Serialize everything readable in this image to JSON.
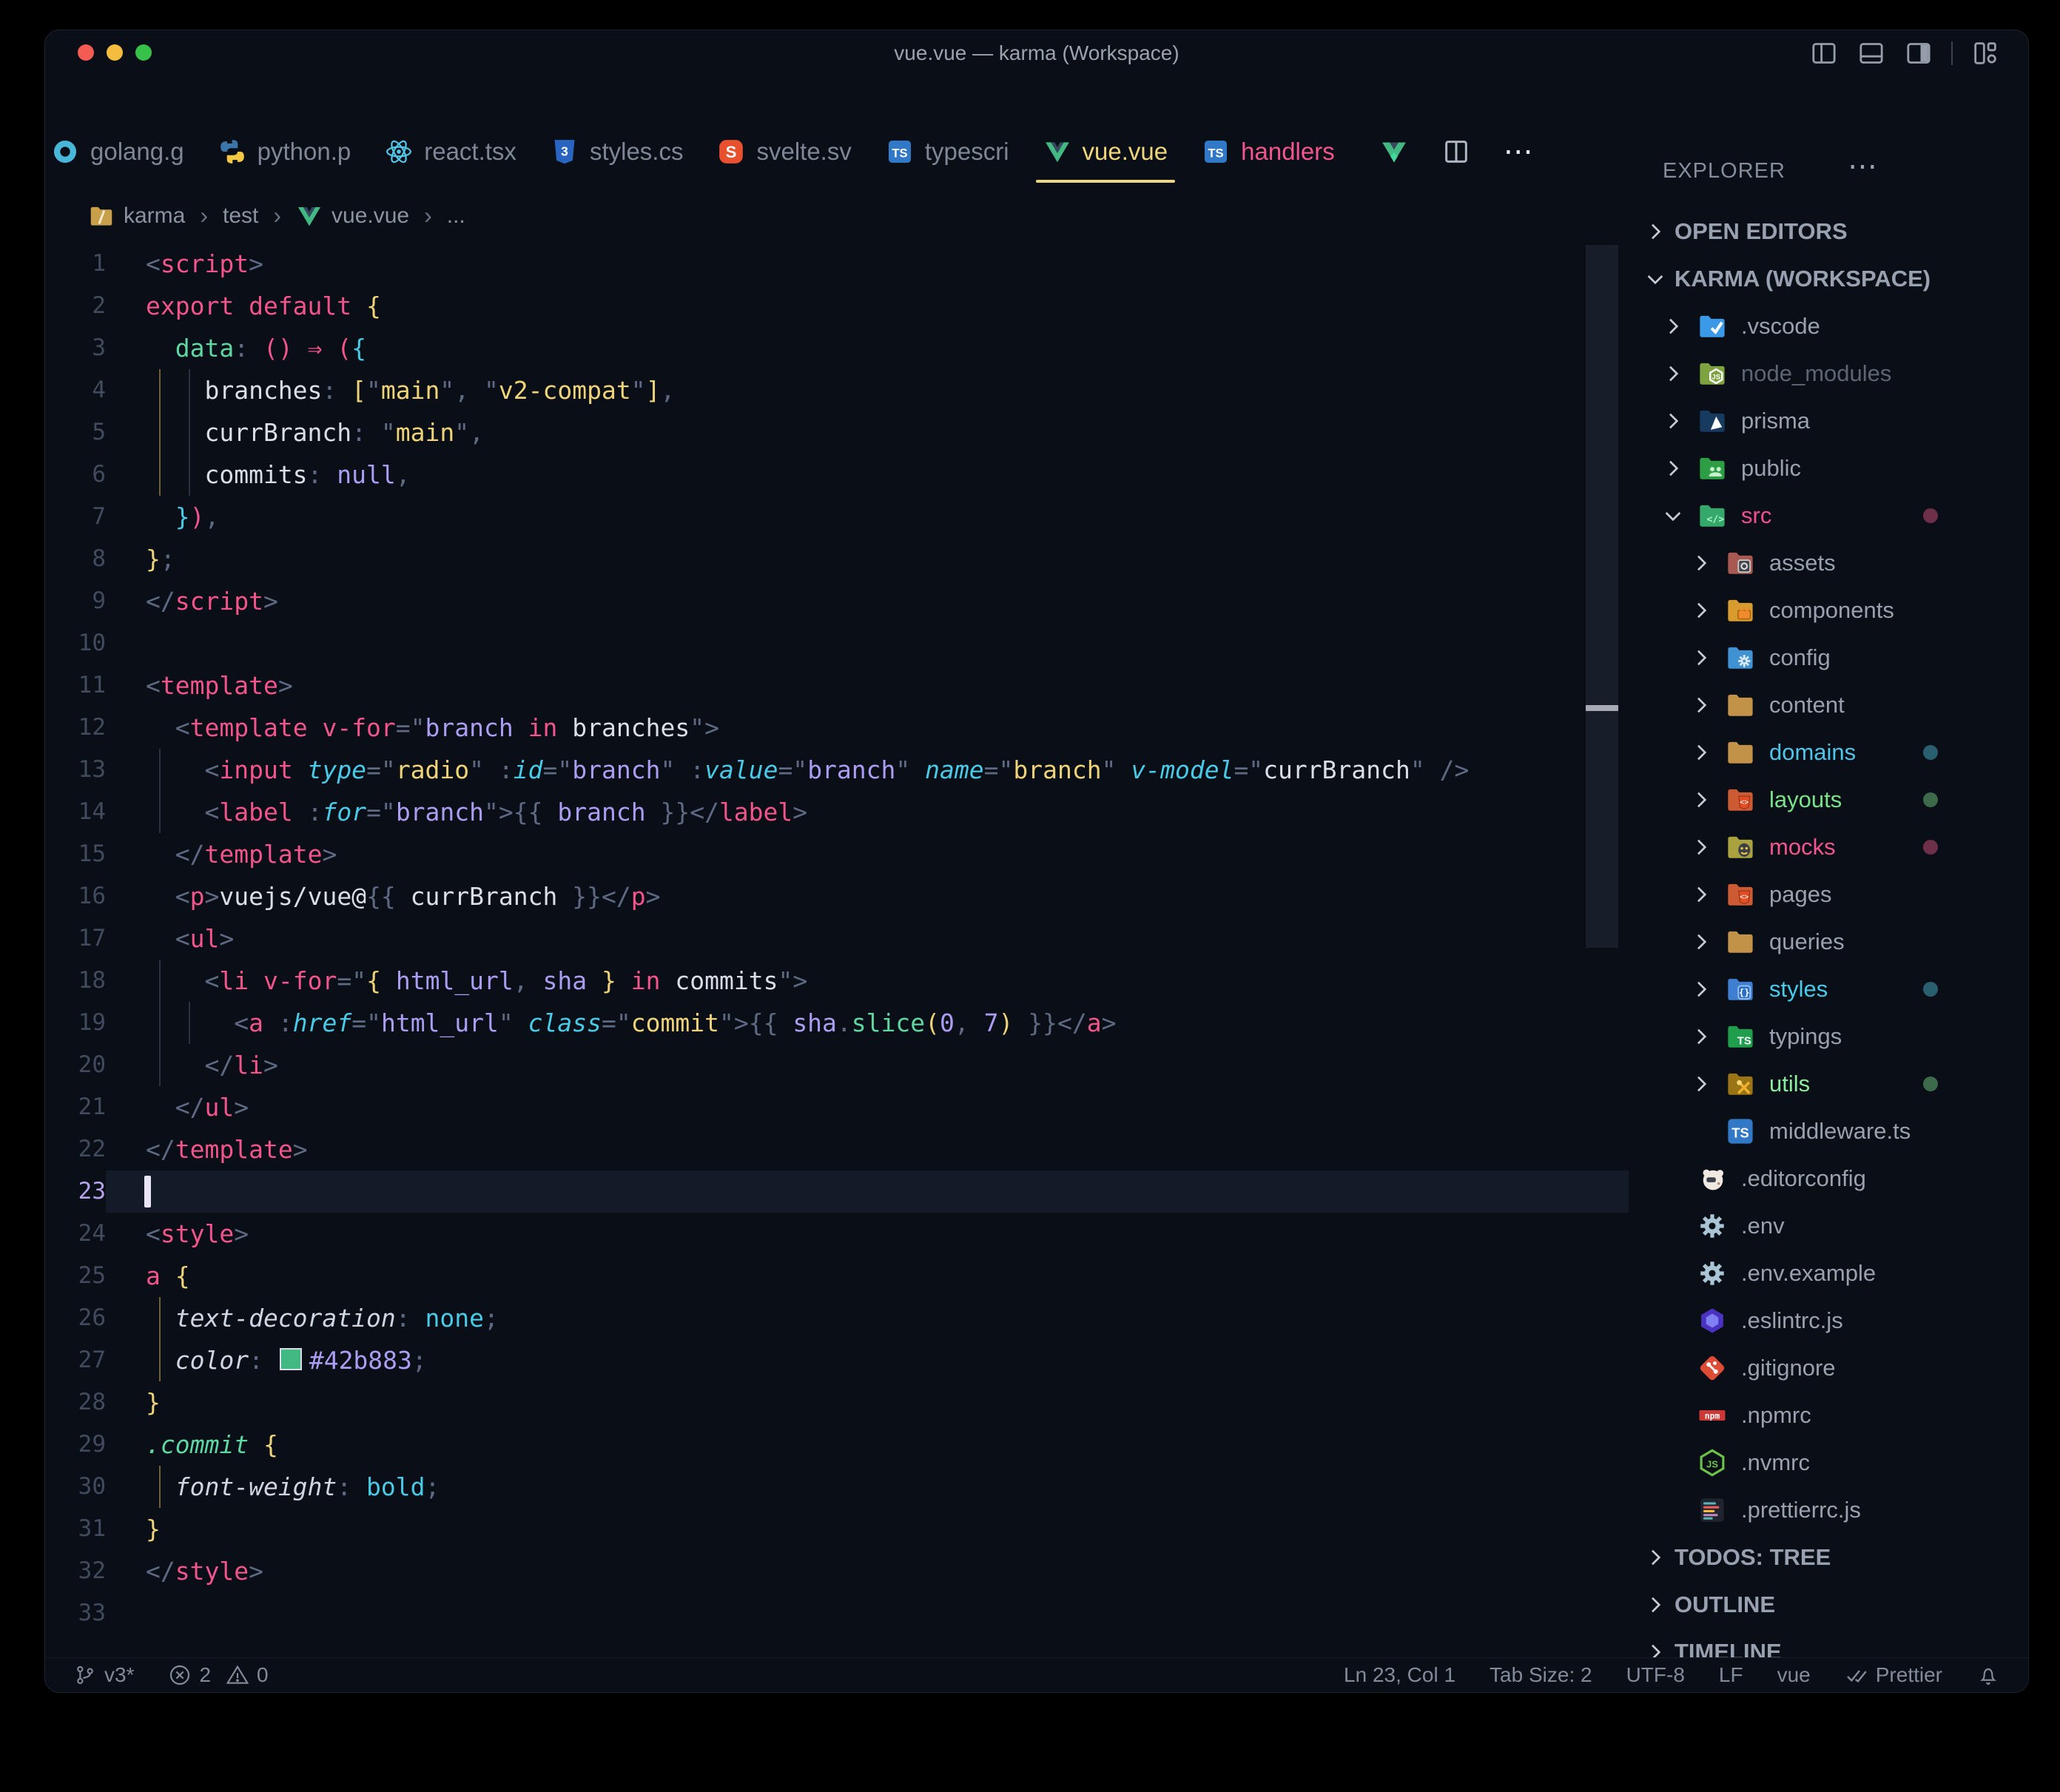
{
  "window": {
    "title": "vue.vue — karma (Workspace)"
  },
  "tab_bar": {
    "tabs": [
      {
        "icon": "go",
        "label": "golang.g"
      },
      {
        "icon": "python",
        "label": "python.p"
      },
      {
        "icon": "react",
        "label": "react.tsx"
      },
      {
        "icon": "css",
        "label": "styles.cs"
      },
      {
        "icon": "svelte",
        "label": "svelte.sv"
      },
      {
        "icon": "ts",
        "label": "typescri"
      },
      {
        "icon": "vue",
        "label": "vue.vue",
        "active": true
      },
      {
        "icon": "ts",
        "label": "handlers",
        "color": "#f1568e"
      }
    ],
    "more_label": "⋯"
  },
  "breadcrumb": {
    "items": [
      {
        "icon": "folder-karma",
        "label": "karma"
      },
      {
        "label": "test"
      },
      {
        "icon": "vue",
        "label": "vue.vue"
      },
      {
        "label": "..."
      }
    ]
  },
  "editor": {
    "cursor": {
      "line": 23,
      "col": 1
    },
    "lines": [
      {
        "n": 1,
        "t": [
          [
            "p",
            "<"
          ],
          [
            "tag",
            "script"
          ],
          [
            "p",
            ">"
          ]
        ]
      },
      {
        "n": 2,
        "t": [
          [
            "kw",
            "export default "
          ],
          [
            "b1",
            "{"
          ]
        ]
      },
      {
        "n": 3,
        "t": [
          [
            "pl",
            "  "
          ],
          [
            "fn",
            "data"
          ],
          [
            "p",
            ": "
          ],
          [
            "b2",
            "() ⇒ ("
          ],
          [
            "b3",
            "{"
          ]
        ]
      },
      {
        "n": 4,
        "t": [
          [
            "igy",
            ""
          ],
          [
            "igg",
            ""
          ],
          [
            "id",
            "branches"
          ],
          [
            "p",
            ": "
          ],
          [
            "b1",
            "["
          ],
          [
            "p",
            "\""
          ],
          [
            "str",
            "main"
          ],
          [
            "p",
            "\", \""
          ],
          [
            "str",
            "v2-compat"
          ],
          [
            "p",
            "\""
          ],
          [
            "b1",
            "]"
          ],
          [
            "p",
            ","
          ]
        ]
      },
      {
        "n": 5,
        "t": [
          [
            "igy",
            ""
          ],
          [
            "igg",
            ""
          ],
          [
            "id",
            "currBranch"
          ],
          [
            "p",
            ": \""
          ],
          [
            "str",
            "main"
          ],
          [
            "p",
            "\","
          ]
        ]
      },
      {
        "n": 6,
        "t": [
          [
            "igy",
            ""
          ],
          [
            "igg",
            ""
          ],
          [
            "id",
            "commits"
          ],
          [
            "p",
            ": "
          ],
          [
            "pur",
            "null"
          ],
          [
            "p",
            ","
          ]
        ]
      },
      {
        "n": 7,
        "t": [
          [
            "pl",
            "  "
          ],
          [
            "b3",
            "}"
          ],
          [
            "b2",
            ")"
          ],
          [
            "p",
            ","
          ]
        ]
      },
      {
        "n": 8,
        "t": [
          [
            "b1",
            "}"
          ],
          [
            "p",
            ";"
          ]
        ]
      },
      {
        "n": 9,
        "t": [
          [
            "p",
            "</"
          ],
          [
            "tag",
            "script"
          ],
          [
            "p",
            ">"
          ]
        ]
      },
      {
        "n": 10,
        "t": []
      },
      {
        "n": 11,
        "t": [
          [
            "p",
            "<"
          ],
          [
            "tag",
            "template"
          ],
          [
            "p",
            ">"
          ]
        ]
      },
      {
        "n": 12,
        "t": [
          [
            "pl",
            "  "
          ],
          [
            "p",
            "<"
          ],
          [
            "tag",
            "template"
          ],
          [
            "pl",
            " "
          ],
          [
            "kw",
            "v-for"
          ],
          [
            "p",
            "=\""
          ],
          [
            "pur",
            "branch"
          ],
          [
            "pl",
            " "
          ],
          [
            "kw",
            "in"
          ],
          [
            "pl",
            " "
          ],
          [
            "id",
            "branches"
          ],
          [
            "p",
            "\">"
          ]
        ]
      },
      {
        "n": 13,
        "t": [
          [
            "igg",
            ""
          ],
          [
            "pl",
            "  "
          ],
          [
            "p",
            "<"
          ],
          [
            "tag",
            "input"
          ],
          [
            "pl",
            " "
          ],
          [
            "attr",
            "type"
          ],
          [
            "p",
            "=\""
          ],
          [
            "str",
            "radio"
          ],
          [
            "p",
            "\" :"
          ],
          [
            "attr",
            "id"
          ],
          [
            "p",
            "=\""
          ],
          [
            "pur",
            "branch"
          ],
          [
            "p",
            "\" :"
          ],
          [
            "attr",
            "value"
          ],
          [
            "p",
            "=\""
          ],
          [
            "pur",
            "branch"
          ],
          [
            "p",
            "\" "
          ],
          [
            "attr",
            "name"
          ],
          [
            "p",
            "=\""
          ],
          [
            "str",
            "branch"
          ],
          [
            "p",
            "\" "
          ],
          [
            "attr",
            "v-model"
          ],
          [
            "p",
            "=\""
          ],
          [
            "id",
            "currBranch"
          ],
          [
            "p",
            "\" />"
          ]
        ]
      },
      {
        "n": 14,
        "t": [
          [
            "igg",
            ""
          ],
          [
            "pl",
            "  "
          ],
          [
            "p",
            "<"
          ],
          [
            "tag",
            "label"
          ],
          [
            "p",
            " :"
          ],
          [
            "attr",
            "for"
          ],
          [
            "p",
            "=\""
          ],
          [
            "pur",
            "branch"
          ],
          [
            "p",
            "\">{{ "
          ],
          [
            "pur",
            "branch"
          ],
          [
            "p",
            " }}</"
          ],
          [
            "tag",
            "label"
          ],
          [
            "p",
            ">"
          ]
        ]
      },
      {
        "n": 15,
        "t": [
          [
            "pl",
            "  "
          ],
          [
            "p",
            "</"
          ],
          [
            "tag",
            "template"
          ],
          [
            "p",
            ">"
          ]
        ]
      },
      {
        "n": 16,
        "t": [
          [
            "pl",
            "  "
          ],
          [
            "p",
            "<"
          ],
          [
            "tag",
            "p"
          ],
          [
            "p",
            ">"
          ],
          [
            "id",
            "vuejs/vue@"
          ],
          [
            "p",
            "{{ "
          ],
          [
            "id",
            "currBranch"
          ],
          [
            "p",
            " }}</"
          ],
          [
            "tag",
            "p"
          ],
          [
            "p",
            ">"
          ]
        ]
      },
      {
        "n": 17,
        "t": [
          [
            "pl",
            "  "
          ],
          [
            "p",
            "<"
          ],
          [
            "tag",
            "ul"
          ],
          [
            "p",
            ">"
          ]
        ]
      },
      {
        "n": 18,
        "t": [
          [
            "igg",
            ""
          ],
          [
            "pl",
            "  "
          ],
          [
            "p",
            "<"
          ],
          [
            "tag",
            "li"
          ],
          [
            "pl",
            " "
          ],
          [
            "kw",
            "v-for"
          ],
          [
            "p",
            "=\""
          ],
          [
            "b1",
            "{"
          ],
          [
            "pl",
            " "
          ],
          [
            "pur",
            "html_url"
          ],
          [
            "p",
            ","
          ],
          [
            "pl",
            " "
          ],
          [
            "pur",
            "sha"
          ],
          [
            "pl",
            " "
          ],
          [
            "b1",
            "}"
          ],
          [
            "pl",
            " "
          ],
          [
            "kw",
            "in"
          ],
          [
            "pl",
            " "
          ],
          [
            "id",
            "commits"
          ],
          [
            "p",
            "\">"
          ]
        ]
      },
      {
        "n": 19,
        "t": [
          [
            "igg",
            ""
          ],
          [
            "igg",
            ""
          ],
          [
            "pl",
            "  "
          ],
          [
            "p",
            "<"
          ],
          [
            "tag",
            "a"
          ],
          [
            "p",
            " :"
          ],
          [
            "attr",
            "href"
          ],
          [
            "p",
            "=\""
          ],
          [
            "pur",
            "html_url"
          ],
          [
            "p",
            "\" "
          ],
          [
            "attr",
            "class"
          ],
          [
            "p",
            "=\""
          ],
          [
            "str",
            "commit"
          ],
          [
            "p",
            "\">{{ "
          ],
          [
            "pur",
            "sha"
          ],
          [
            "p",
            "."
          ],
          [
            "fn",
            "slice"
          ],
          [
            "b1",
            "("
          ],
          [
            "pur",
            "0"
          ],
          [
            "p",
            ", "
          ],
          [
            "pur",
            "7"
          ],
          [
            "b1",
            ")"
          ],
          [
            "p",
            " }}</"
          ],
          [
            "tag",
            "a"
          ],
          [
            "p",
            ">"
          ]
        ]
      },
      {
        "n": 20,
        "t": [
          [
            "igg",
            ""
          ],
          [
            "pl",
            "  "
          ],
          [
            "p",
            "</"
          ],
          [
            "tag",
            "li"
          ],
          [
            "p",
            ">"
          ]
        ]
      },
      {
        "n": 21,
        "t": [
          [
            "pl",
            "  "
          ],
          [
            "p",
            "</"
          ],
          [
            "tag",
            "ul"
          ],
          [
            "p",
            ">"
          ]
        ]
      },
      {
        "n": 22,
        "t": [
          [
            "p",
            "</"
          ],
          [
            "tag",
            "template"
          ],
          [
            "p",
            ">"
          ]
        ]
      },
      {
        "n": 23,
        "t": [],
        "current": true
      },
      {
        "n": 24,
        "t": [
          [
            "p",
            "<"
          ],
          [
            "tag",
            "style"
          ],
          [
            "p",
            ">"
          ]
        ]
      },
      {
        "n": 25,
        "t": [
          [
            "tag",
            "a "
          ],
          [
            "b1",
            "{"
          ]
        ]
      },
      {
        "n": 26,
        "t": [
          [
            "igy",
            ""
          ],
          [
            "prop",
            "text-decoration"
          ],
          [
            "p",
            ": "
          ],
          [
            "val",
            "none"
          ],
          [
            "p",
            ";"
          ]
        ]
      },
      {
        "n": 27,
        "t": [
          [
            "igy",
            ""
          ],
          [
            "prop",
            "color"
          ],
          [
            "p",
            ": "
          ],
          [
            "sw",
            ""
          ],
          [
            "pur",
            "#42b883"
          ],
          [
            "p",
            ";"
          ]
        ]
      },
      {
        "n": 28,
        "t": [
          [
            "b1",
            "}"
          ]
        ]
      },
      {
        "n": 29,
        "t": [
          [
            "cls",
            ".commit "
          ],
          [
            "b1",
            "{"
          ]
        ]
      },
      {
        "n": 30,
        "t": [
          [
            "igy",
            ""
          ],
          [
            "prop",
            "font-weight"
          ],
          [
            "p",
            ": "
          ],
          [
            "val",
            "bold"
          ],
          [
            "p",
            ";"
          ]
        ]
      },
      {
        "n": 31,
        "t": [
          [
            "b1",
            "}"
          ]
        ]
      },
      {
        "n": 32,
        "t": [
          [
            "p",
            "</"
          ],
          [
            "tag",
            "style"
          ],
          [
            "p",
            ">"
          ]
        ]
      },
      {
        "n": 33,
        "t": []
      }
    ]
  },
  "sidebar": {
    "title": "EXPLORER",
    "title_more": "⋯",
    "sections": [
      {
        "label": "OPEN EDITORS",
        "expanded": false
      },
      {
        "label": "KARMA (WORKSPACE)",
        "expanded": true
      }
    ],
    "tree": [
      {
        "lvl": 0,
        "chev": "right",
        "icon": "vscode",
        "label": ".vscode"
      },
      {
        "lvl": 0,
        "chev": "right",
        "icon": "node_modules",
        "label": "node_modules",
        "dim": true
      },
      {
        "lvl": 0,
        "chev": "right",
        "icon": "prisma",
        "label": "prisma"
      },
      {
        "lvl": 0,
        "chev": "right",
        "icon": "public",
        "label": "public"
      },
      {
        "lvl": 0,
        "chev": "down",
        "icon": "src",
        "label": "src",
        "color": "#f1508c",
        "badge": "#6e3048"
      },
      {
        "lvl": 1,
        "chev": "right",
        "icon": "assets",
        "label": "assets"
      },
      {
        "lvl": 1,
        "chev": "right",
        "icon": "components",
        "label": "components"
      },
      {
        "lvl": 1,
        "chev": "right",
        "icon": "config",
        "label": "config"
      },
      {
        "lvl": 1,
        "chev": "right",
        "icon": "content",
        "label": "content"
      },
      {
        "lvl": 1,
        "chev": "right",
        "icon": "content",
        "label": "domains",
        "color": "#4fc6ea",
        "badge": "#2a5f70"
      },
      {
        "lvl": 1,
        "chev": "right",
        "icon": "layouts",
        "label": "layouts",
        "color": "#79e38b",
        "badge": "#3c6a4a"
      },
      {
        "lvl": 1,
        "chev": "right",
        "icon": "mocks",
        "label": "mocks",
        "color": "#f1568e",
        "badge": "#6e3048"
      },
      {
        "lvl": 1,
        "chev": "right",
        "icon": "layouts",
        "label": "pages"
      },
      {
        "lvl": 1,
        "chev": "right",
        "icon": "content",
        "label": "queries"
      },
      {
        "lvl": 1,
        "chev": "right",
        "icon": "styles",
        "label": "styles",
        "color": "#45cdea",
        "badge": "#2a5f70"
      },
      {
        "lvl": 1,
        "chev": "right",
        "icon": "typings",
        "label": "typings"
      },
      {
        "lvl": 1,
        "chev": "right",
        "icon": "utils",
        "label": "utils",
        "color": "#8ceb9e",
        "badge": "#3c6a4a"
      },
      {
        "lvl": 1,
        "chev": null,
        "icon": "tsfile",
        "label": "middleware.ts"
      },
      {
        "lvl": 0,
        "chev": null,
        "icon": "editorconfig",
        "label": ".editorconfig"
      },
      {
        "lvl": 0,
        "chev": null,
        "icon": "gear",
        "label": ".env"
      },
      {
        "lvl": 0,
        "chev": null,
        "icon": "gear",
        "label": ".env.example"
      },
      {
        "lvl": 0,
        "chev": null,
        "icon": "eslint",
        "label": ".eslintrc.js"
      },
      {
        "lvl": 0,
        "chev": null,
        "icon": "git",
        "label": ".gitignore"
      },
      {
        "lvl": 0,
        "chev": null,
        "icon": "npm",
        "label": ".npmrc"
      },
      {
        "lvl": 0,
        "chev": null,
        "icon": "node",
        "label": ".nvmrc"
      },
      {
        "lvl": 0,
        "chev": null,
        "icon": "prettier",
        "label": ".prettierrc.js"
      }
    ],
    "bottom_sections": [
      "TODOS: TREE",
      "OUTLINE",
      "TIMELINE"
    ]
  },
  "statusbar": {
    "branch": "v3*",
    "errors": "2",
    "warnings": "0",
    "right": [
      "Ln 23, Col 1",
      "Tab Size: 2",
      "UTF-8",
      "LF",
      "vue",
      "Prettier"
    ]
  },
  "colors": {
    "accent_yellow": "#efd57b",
    "accent_pink": "#f2548c",
    "vue_green": "#42b883",
    "background": "#0a0e16"
  }
}
